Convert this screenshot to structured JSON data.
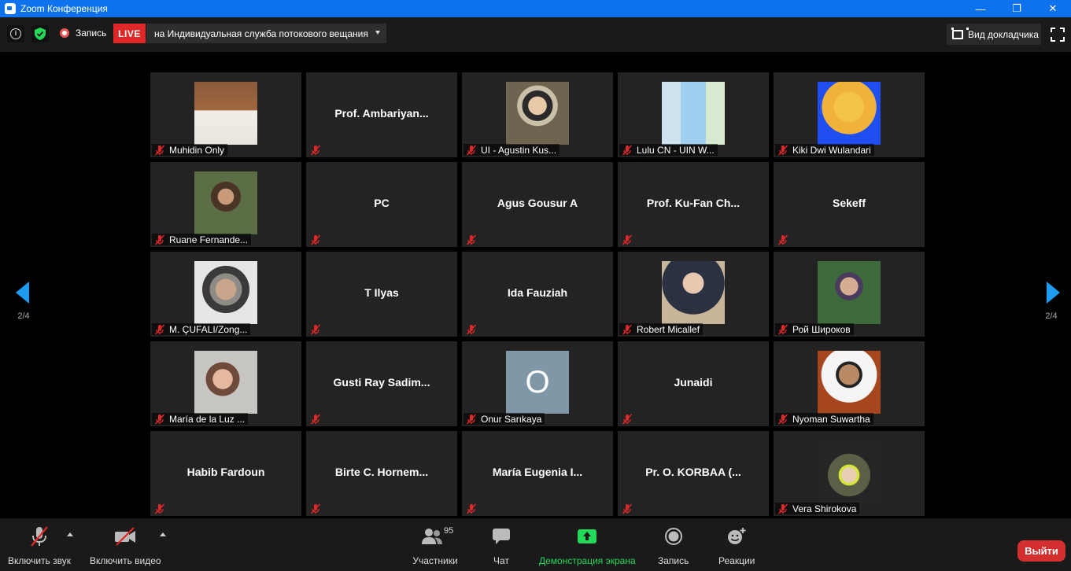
{
  "window": {
    "title": "Zoom Конференция",
    "minimize": "—",
    "maximize": "❐",
    "close": "✕"
  },
  "topbar": {
    "info": "i",
    "recording_label": "Запись",
    "live_badge": "LIVE",
    "live_destination": "на Индивидуальная служба потокового вещания",
    "speaker_view_label": "Вид докладчика"
  },
  "navigation": {
    "page_left": "2/4",
    "page_right": "2/4"
  },
  "participants": [
    {
      "name": "Muhidin Only",
      "video": true,
      "display": ""
    },
    {
      "name": "",
      "video": false,
      "display": "Prof.  Ambariyan..."
    },
    {
      "name": "UI - Agustin Kus...",
      "video": true,
      "display": ""
    },
    {
      "name": "Lulu CN - UIN W...",
      "video": true,
      "display": ""
    },
    {
      "name": "Kiki Dwi Wulandari",
      "video": true,
      "display": ""
    },
    {
      "name": "Ruane Fernande...",
      "video": true,
      "display": ""
    },
    {
      "name": "",
      "video": false,
      "display": "PC"
    },
    {
      "name": "",
      "video": false,
      "display": "Agus Gousur A"
    },
    {
      "name": "",
      "video": false,
      "display": "Prof.  Ku-Fan Ch..."
    },
    {
      "name": "",
      "video": false,
      "display": "Sekeff"
    },
    {
      "name": "M. ÇUFALI/Zong...",
      "video": true,
      "display": ""
    },
    {
      "name": "",
      "video": false,
      "display": "T Ilyas"
    },
    {
      "name": "",
      "video": false,
      "display": "Ida Fauziah"
    },
    {
      "name": "Robert Micallef",
      "video": true,
      "display": ""
    },
    {
      "name": "Рой Широков",
      "video": true,
      "display": ""
    },
    {
      "name": "María de la Luz ...",
      "video": true,
      "display": ""
    },
    {
      "name": "",
      "video": false,
      "display": "Gusti  Ray  Sadim..."
    },
    {
      "name": "Onur Sarıkaya",
      "video": true,
      "display": "O"
    },
    {
      "name": "",
      "video": false,
      "display": "Junaidi"
    },
    {
      "name": "Nyoman Suwartha",
      "video": true,
      "display": ""
    },
    {
      "name": "",
      "video": false,
      "display": "Habib Fardoun"
    },
    {
      "name": "",
      "video": false,
      "display": "Birte  C.  Hornem..."
    },
    {
      "name": "",
      "video": false,
      "display": "María  Eugenia  I..."
    },
    {
      "name": "",
      "video": false,
      "display": "Pr.  O.  KORBAA  (..."
    },
    {
      "name": "Vera Shirokova",
      "video": true,
      "display": ""
    }
  ],
  "toolbar": {
    "unmute_label": "Включить звук",
    "start_video_label": "Включить видео",
    "participants_label": "Участники",
    "participants_count": "95",
    "chat_label": "Чат",
    "share_label": "Демонстрация экрана",
    "record_label": "Запись",
    "reactions_label": "Реакции",
    "leave_label": "Выйти"
  },
  "colors": {
    "titlebar": "#0e72ed",
    "live": "#e02828",
    "share_green": "#23d959",
    "nav_arrow": "#1d9bf0",
    "leave": "#d32f2f",
    "mic_off": "#e02828"
  }
}
